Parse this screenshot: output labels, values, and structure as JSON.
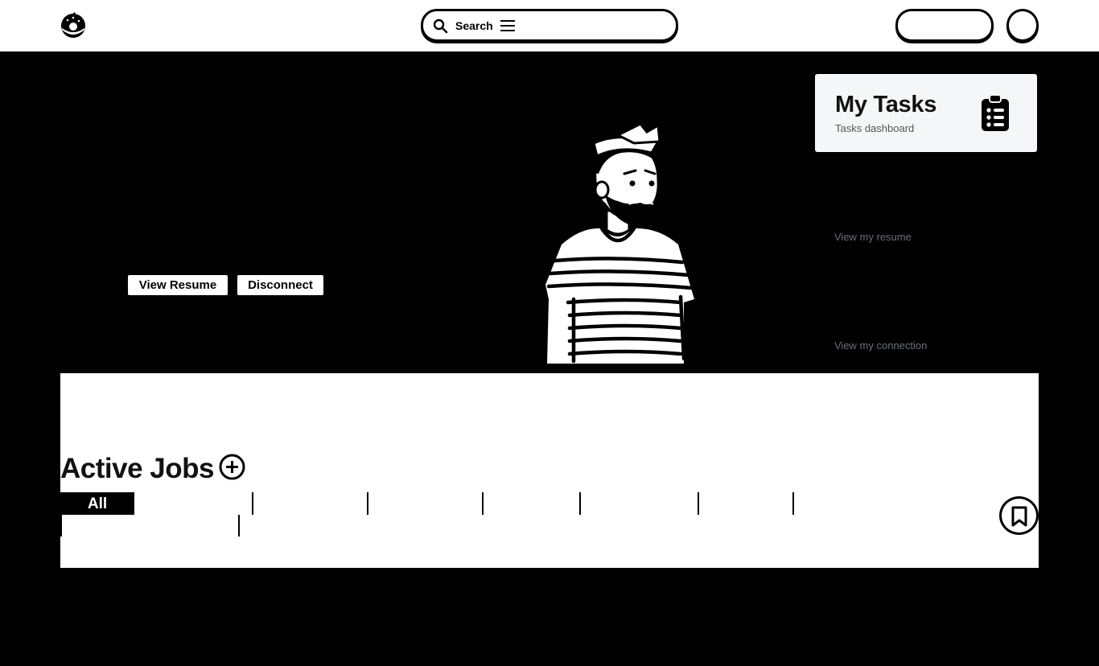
{
  "header": {
    "logo_icon": "donut-icon",
    "search": {
      "label": "Search",
      "icon": "search-icon",
      "menu_icon": "menu-icon"
    }
  },
  "hero": {
    "view_resume_label": "View Resume",
    "disconnect_label": "Disconnect",
    "illustration": "bearded-man-illustration"
  },
  "tasks_card": {
    "title": "My Tasks",
    "subtitle": "Tasks dashboard",
    "icon": "clipboard-icon"
  },
  "links": {
    "resume": "View my resume",
    "connection": "View my connection"
  },
  "jobs": {
    "title": "Active Jobs",
    "add_icon": "plus-circle-icon",
    "tabs": [
      "All"
    ],
    "bookmark_icon": "bookmark-icon"
  },
  "colors": {
    "primary": "#000000",
    "background": "#ffffff",
    "card": "#f5f6f8",
    "link": "#6a6f7c"
  }
}
